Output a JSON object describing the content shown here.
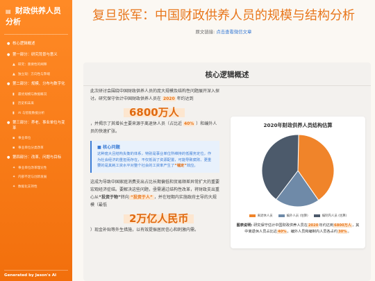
{
  "sidebar": {
    "title": "财政供养人员分析",
    "items": [
      {
        "label": "核心逻辑概述",
        "sub": false,
        "icon": "pin-icon"
      },
      {
        "label": "第一部分：研究背景与意义",
        "sub": false,
        "icon": "pin-icon"
      },
      {
        "label": "研究：重要性的阐释",
        "sub": true,
        "icon": "person-icon"
      },
      {
        "label": "独立观：方向性与弊端",
        "sub": true,
        "icon": "person-icon"
      },
      {
        "label": "第二部分：规模、分布与数字化",
        "sub": false,
        "icon": "pin-icon"
      },
      {
        "label": "最优规模与数据概况",
        "sub": true,
        "icon": "chart-icon"
      },
      {
        "label": "历史和未来",
        "sub": true,
        "icon": "chart-icon"
      },
      {
        "label": "AI 与智能数据分析",
        "sub": true,
        "icon": "chart-icon"
      },
      {
        "label": "第三部分：养老、事业单位与变革",
        "sub": false,
        "icon": "pin-icon"
      },
      {
        "label": "事业单位",
        "sub": true,
        "icon": "doc-icon"
      },
      {
        "label": "事业单位分类改革",
        "sub": true,
        "icon": "doc-icon"
      },
      {
        "label": "第四部分：改革、问题与目标",
        "sub": false,
        "icon": "pin-icon"
      },
      {
        "label": "事业单位改革理论性",
        "sub": true,
        "icon": "gear-icon"
      },
      {
        "label": "内部不足与创新发展",
        "sub": true,
        "icon": "gear-icon"
      },
      {
        "label": "数据化支持性",
        "sub": true,
        "icon": "gear-icon"
      }
    ],
    "footer": "Generated by Jason's AI"
  },
  "header": {
    "title": "复旦张军：中国财政供养人员的规模与结构分析",
    "source_prefix": "原文链接:",
    "source_link": "点击查看微信文章"
  },
  "section": {
    "title": "核心逻辑概述",
    "p1": "此次研讨会围绕中国财政供养人员的庞大规模及结构性问题展开深入探讨。研究保守估计中国财政供养人员在",
    "p1_year": "2020",
    "p1_end": "年约达到",
    "big1": "6800万人",
    "p2_start": "，并揭示了其增长主要来源于离退休人员（占比近",
    "p2_pct": "40%",
    "p2_end": "）和编外人员的快速扩张。",
    "core_title": "核心问题",
    "core_text_1": "这种庞大且结构失衡的体系，特别是事业单位所维持的低服务定位，作为社会经济的重担而存在，不仅抵消了资源配置，可能导致腐败、更重要的是其耗工资水平对整个社会的工资率产生了",
    "core_em": "“锚定”",
    "core_text_2": "效应。",
    "p3_start": "这成为导致中国家庭消费支出占比长期偏低和贸易顺差异常扩大的重要宏观经济症结。要解决这些问题，亟需通过结构性改革，将财政支出重心从",
    "p3_q1": "“投资于物”",
    "p3_mid": "转向",
    "p3_q2": "“投资于人”",
    "p3_end": "，并在短期内实施政府主导的大规模（最低",
    "big2": "2万亿人民币",
    "p4": "）现金补贴等外生措施，以有效提振居民信心和刺激内需。"
  },
  "chart_data": {
    "type": "pie",
    "title": "2020年财政供养人员结构估算",
    "categories": [
      "离退休人员",
      "编外人员 (估算)",
      "编制内人员 (估算)"
    ],
    "values": [
      40,
      20,
      40
    ],
    "colors": [
      "#f0842a",
      "#6f8aa8",
      "#4c5a6b"
    ],
    "legend_position": "bottom",
    "note_label": "图表说明:",
    "note_1": "研究保守估计中国财政供养人员在",
    "note_year": "2020",
    "note_2": "年约达到",
    "note_total": "6800万人",
    "note_3": "，其中离退休人员占比近",
    "note_pct": "40%",
    "note_4": "。编外人员和编制内人员各占约",
    "note_pct2": "30%",
    "note_5": "。"
  }
}
